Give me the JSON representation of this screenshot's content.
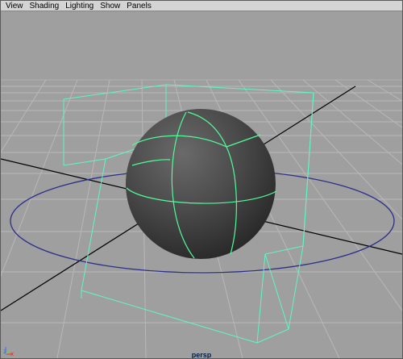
{
  "menubar": {
    "items": [
      {
        "label": "View"
      },
      {
        "label": "Shading"
      },
      {
        "label": "Lighting"
      },
      {
        "label": "Show"
      },
      {
        "label": "Panels"
      }
    ]
  },
  "viewport": {
    "camera_label": "persp",
    "axis_labels": {
      "z": "z",
      "x": "x"
    },
    "colors": {
      "background": "#9f9f9f",
      "grid": "#b5b5b5",
      "grid_axis": "#000000",
      "bounding_box": "#5ff7c3",
      "sphere_wire": "#4ffd9a",
      "ground_circle": "#2c2d8a",
      "sphere_fill": "#4a4a4a"
    }
  }
}
